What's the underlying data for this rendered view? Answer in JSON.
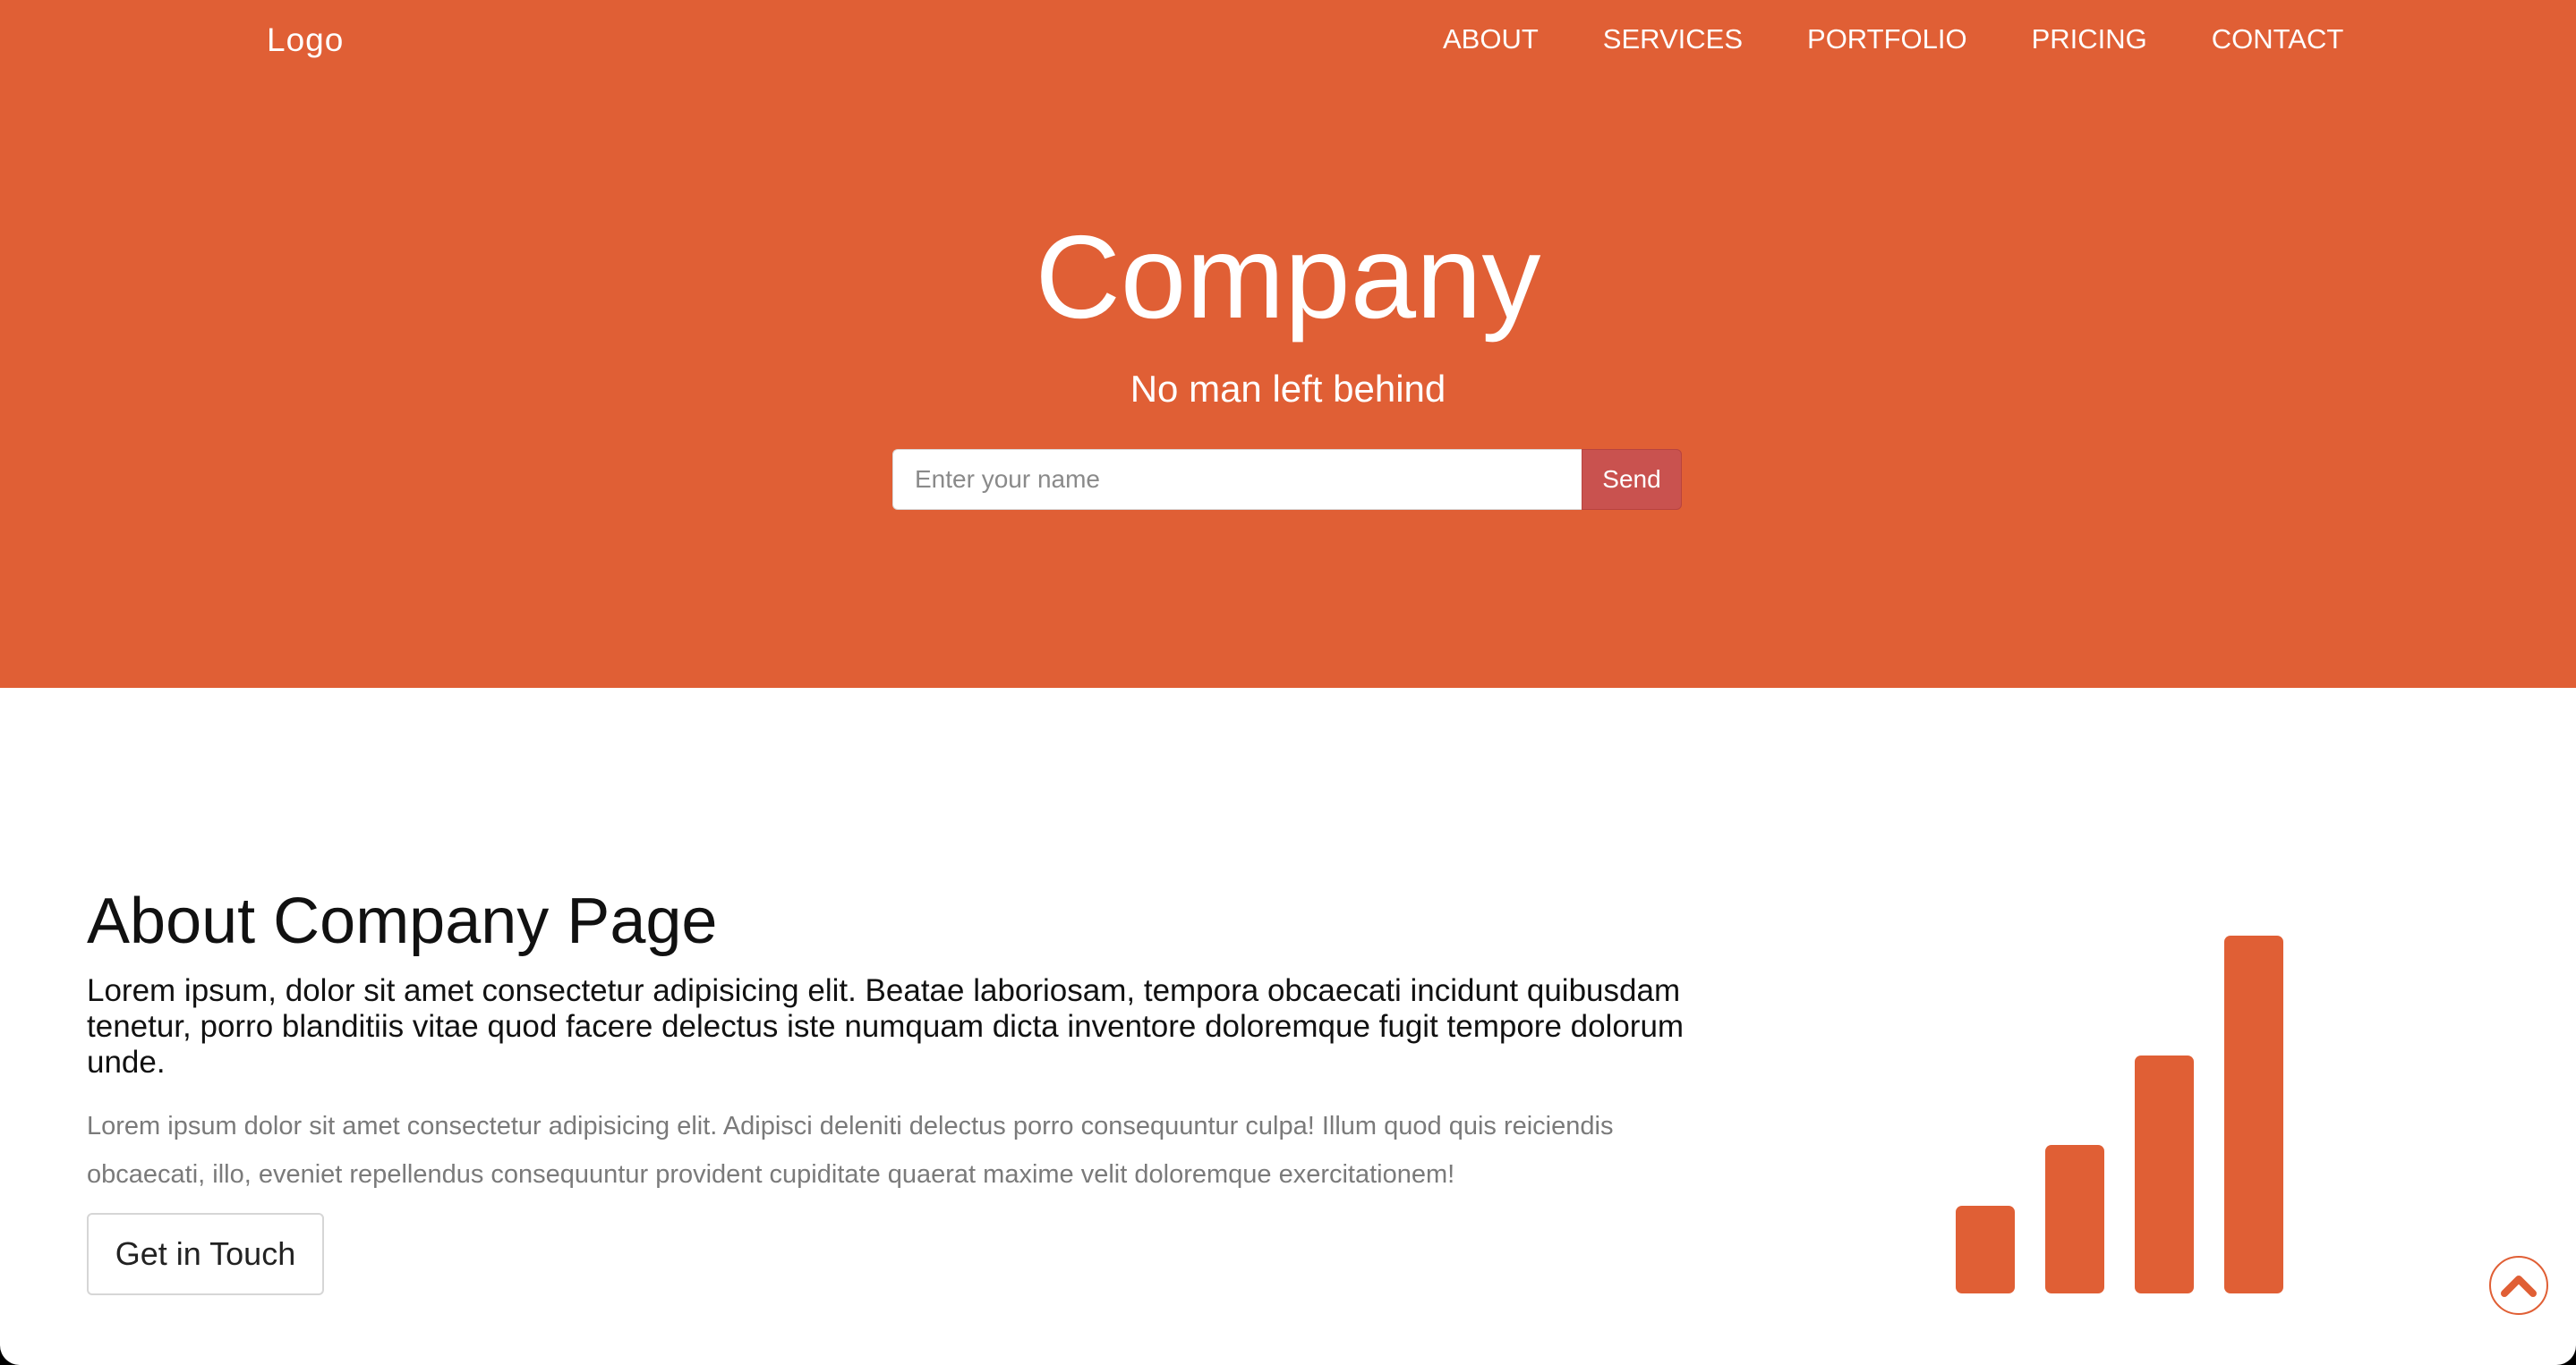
{
  "colors": {
    "accent": "#e05f35",
    "send_button": "#c9524f",
    "background": "#ffffff"
  },
  "header": {
    "logo": "Logo",
    "nav": [
      "ABOUT",
      "SERVICES",
      "PORTFOLIO",
      "PRICING",
      "CONTACT"
    ]
  },
  "hero": {
    "title": "Company",
    "subtitle": "No man left behind",
    "input": {
      "placeholder": "Enter your name",
      "value": ""
    },
    "send_label": "Send"
  },
  "about": {
    "title": "About Company Page",
    "lead": "Lorem ipsum, dolor sit amet consectetur adipisicing elit. Beatae laboriosam, tempora obcaecati incidunt quibusdam tenetur, porro blanditiis vitae quod facere delectus iste numquam dicta inventore doloremque fugit tempore dolorum unde.",
    "body": "Lorem ipsum dolor sit amet consectetur adipisicing elit. Adipisci deleniti delectus porro consequuntur culpa! Illum quod quis reiciendis obcaecati, illo, eveniet repellendus consequuntur provident cupiditate quaerat maxime velit doloremque exercitationem!",
    "cta_label": "Get in Touch",
    "icon": "signal-bars-icon"
  },
  "scroll_top": {
    "icon": "chevron-up-icon"
  }
}
